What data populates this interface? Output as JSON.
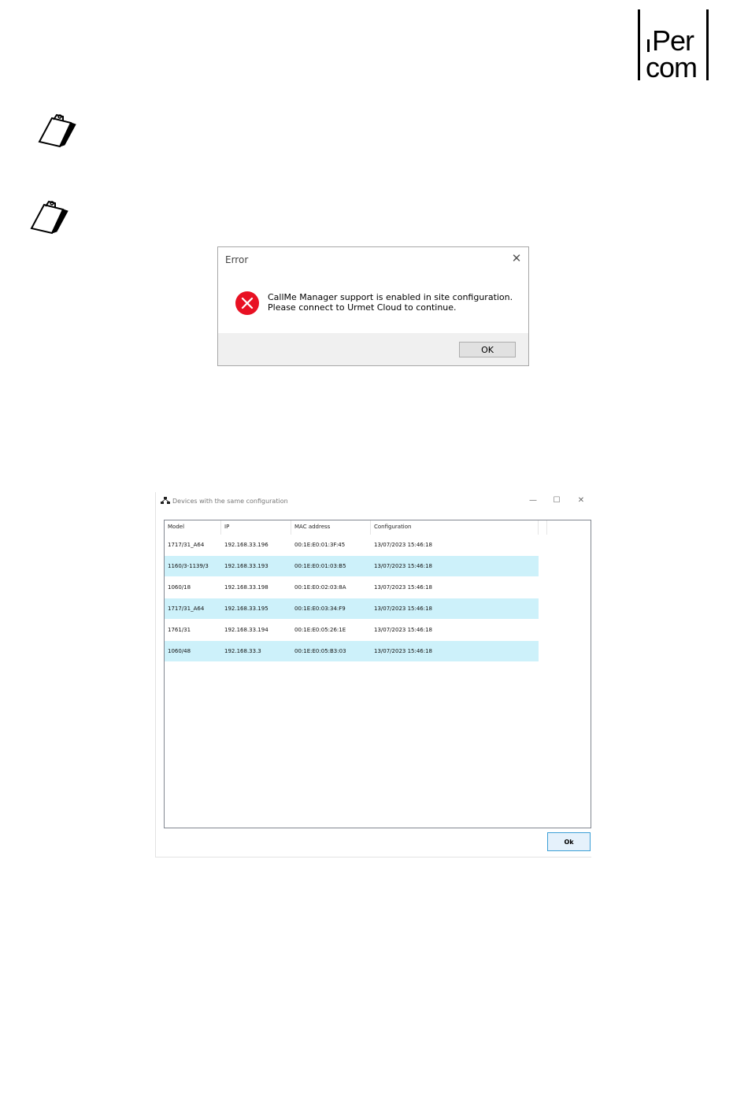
{
  "logo": {
    "line1": "Per",
    "line2": "com"
  },
  "error_dialog": {
    "title": "Error",
    "close_glyph": "✕",
    "message_line1": "CallMe Manager support is enabled in site configuration.",
    "message_line2": "Please connect to Urmet Cloud to continue.",
    "ok_label": "OK",
    "icon": "error-icon",
    "icon_color": "#e81123"
  },
  "devices_window": {
    "title": "Devices with the same configuration",
    "minimize_glyph": "—",
    "maximize_glyph": "☐",
    "close_glyph": "✕",
    "columns": [
      "Model",
      "IP",
      "MAC address",
      "Configuration"
    ],
    "rows": [
      {
        "model": "1717/31_A64",
        "ip": "192.168.33.196",
        "mac": "00:1E:E0:01:3F:45",
        "configuration": "13/07/2023 15:46:18"
      },
      {
        "model": "1160/3-1139/3",
        "ip": "192.168.33.193",
        "mac": "00:1E:E0:01:03:B5",
        "configuration": "13/07/2023 15:46:18"
      },
      {
        "model": "1060/18",
        "ip": "192.168.33.198",
        "mac": "00:1E:E0:02:03:8A",
        "configuration": "13/07/2023 15:46:18"
      },
      {
        "model": "1717/31_A64",
        "ip": "192.168.33.195",
        "mac": "00:1E:E0:03:34:F9",
        "configuration": "13/07/2023 15:46:18"
      },
      {
        "model": "1761/31",
        "ip": "192.168.33.194",
        "mac": "00:1E:E0:05:26:1E",
        "configuration": "13/07/2023 15:46:18"
      },
      {
        "model": "1060/48",
        "ip": "192.168.33.3",
        "mac": "00:1E:E0:05:B3:03",
        "configuration": "13/07/2023 15:46:18"
      }
    ],
    "row_highlight_color": "#cdf1fa",
    "ok_label": "Ok"
  },
  "icons": [
    "note-clipboard-icon",
    "note-clipboard-icon",
    "error-icon",
    "network-app-icon"
  ]
}
